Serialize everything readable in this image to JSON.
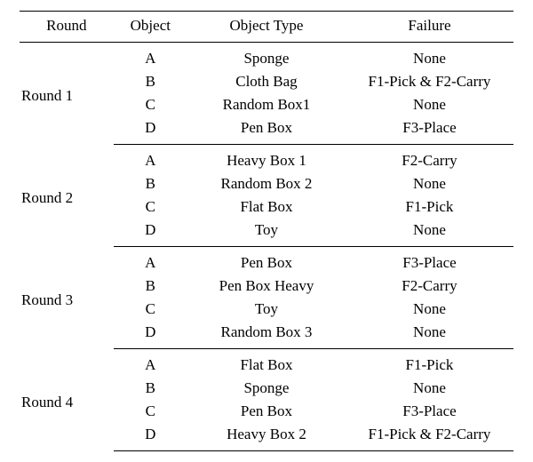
{
  "columns": {
    "round": "Round",
    "object": "Object",
    "object_type": "Object Type",
    "failure": "Failure"
  },
  "rounds": [
    {
      "name": "Round 1",
      "rows": [
        {
          "object": "A",
          "object_type": "Sponge",
          "failure": "None"
        },
        {
          "object": "B",
          "object_type": "Cloth Bag",
          "failure": "F1-Pick & F2-Carry"
        },
        {
          "object": "C",
          "object_type": "Random Box1",
          "failure": "None"
        },
        {
          "object": "D",
          "object_type": "Pen Box",
          "failure": "F3-Place"
        }
      ]
    },
    {
      "name": "Round 2",
      "rows": [
        {
          "object": "A",
          "object_type": "Heavy Box 1",
          "failure": "F2-Carry"
        },
        {
          "object": "B",
          "object_type": "Random Box 2",
          "failure": "None"
        },
        {
          "object": "C",
          "object_type": "Flat Box",
          "failure": "F1-Pick"
        },
        {
          "object": "D",
          "object_type": "Toy",
          "failure": "None"
        }
      ]
    },
    {
      "name": "Round 3",
      "rows": [
        {
          "object": "A",
          "object_type": "Pen Box",
          "failure": "F3-Place"
        },
        {
          "object": "B",
          "object_type": "Pen Box Heavy",
          "failure": "F2-Carry"
        },
        {
          "object": "C",
          "object_type": "Toy",
          "failure": "None"
        },
        {
          "object": "D",
          "object_type": "Random Box 3",
          "failure": "None"
        }
      ]
    },
    {
      "name": "Round 4",
      "rows": [
        {
          "object": "A",
          "object_type": "Flat Box",
          "failure": "F1-Pick"
        },
        {
          "object": "B",
          "object_type": "Sponge",
          "failure": "None"
        },
        {
          "object": "C",
          "object_type": "Pen Box",
          "failure": "F3-Place"
        },
        {
          "object": "D",
          "object_type": "Heavy Box 2",
          "failure": "F1-Pick & F2-Carry"
        }
      ]
    }
  ]
}
